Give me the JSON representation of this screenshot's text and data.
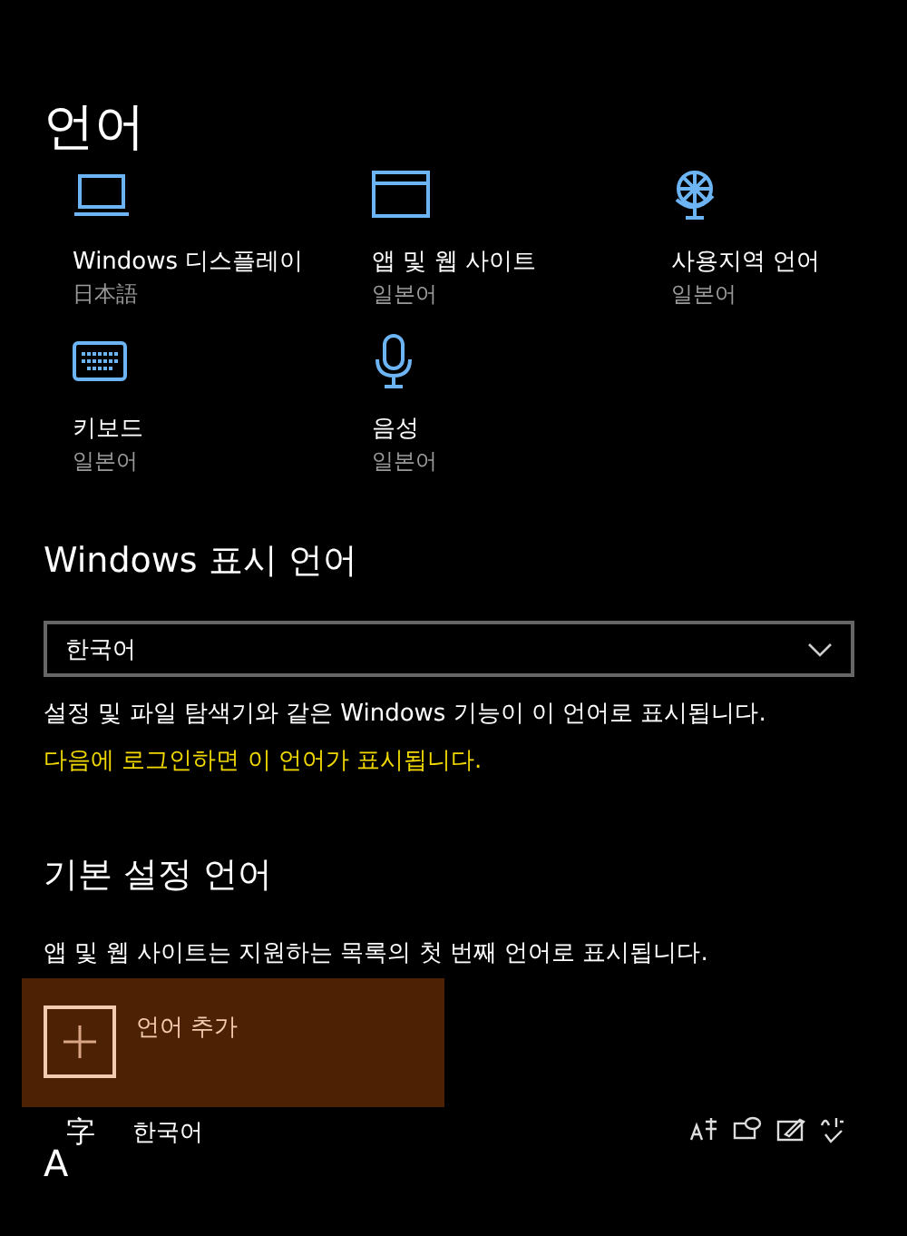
{
  "title": "언어",
  "tiles": [
    {
      "kind": "laptop",
      "label": "Windows 디스플레이",
      "value": "日本語"
    },
    {
      "kind": "window",
      "label": "앱 및 웹 사이트",
      "value": "일본어"
    },
    {
      "kind": "globe",
      "label": "사용지역 언어",
      "value": "일본어"
    },
    {
      "kind": "keyboard",
      "label": "키보드",
      "value": "일본어"
    },
    {
      "kind": "microphone",
      "label": "음성",
      "value": "일본어"
    }
  ],
  "display_language": {
    "heading": "Windows 표시 언어",
    "dropdown": "한국어",
    "description": "설정 및 파일 탐색기와 같은 Windows 기능이 이 언어로 표시됩니다.",
    "notice": "다음에 로그인하면 이 언어가 표시됩니다."
  },
  "preferred_languages": {
    "heading": "기본 설정 언어",
    "description": "앱 및 웹 사이트는 지원하는 목록의 첫 번째 언어로 표시됩니다.",
    "add_button": "언어 추가",
    "languages": [
      {
        "glyph_letter": "A",
        "glyph_char": "字",
        "name": "한국어",
        "features": [
          {
            "kind": "display"
          },
          {
            "kind": "speech"
          },
          {
            "kind": "handwriting"
          },
          {
            "kind": "spelling"
          }
        ]
      }
    ]
  }
}
